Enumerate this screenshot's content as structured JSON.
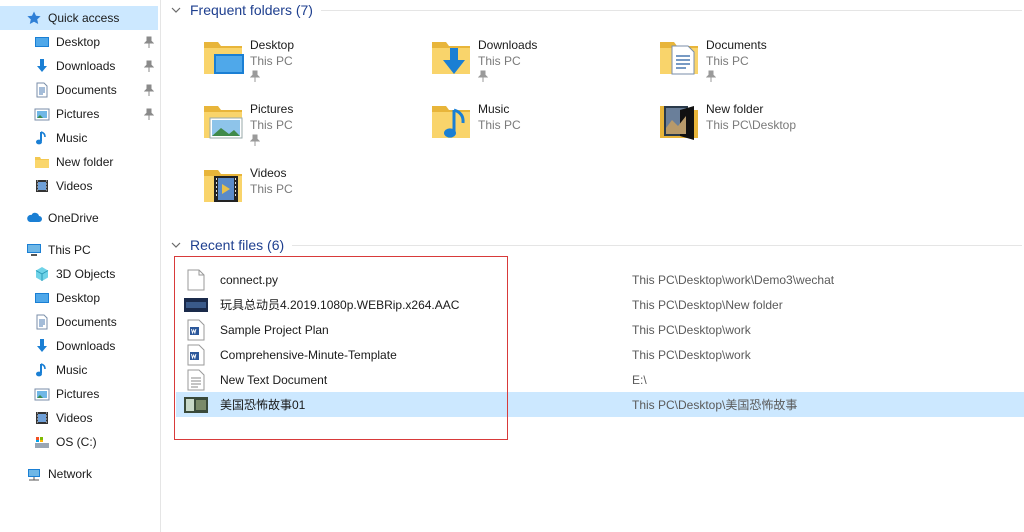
{
  "sidebar": {
    "quick_access": "Quick access",
    "qa_items": [
      {
        "label": "Desktop",
        "icon": "desktop-icon",
        "pinned": true
      },
      {
        "label": "Downloads",
        "icon": "downloads-icon",
        "pinned": true
      },
      {
        "label": "Documents",
        "icon": "documents-icon",
        "pinned": true
      },
      {
        "label": "Pictures",
        "icon": "pictures-icon",
        "pinned": true
      },
      {
        "label": "Music",
        "icon": "music-icon",
        "pinned": false
      },
      {
        "label": "New folder",
        "icon": "folder-icon",
        "pinned": false
      },
      {
        "label": "Videos",
        "icon": "videos-icon",
        "pinned": false
      }
    ],
    "onedrive": "OneDrive",
    "this_pc": "This PC",
    "pc_items": [
      {
        "label": "3D Objects",
        "icon": "3d-objects-icon"
      },
      {
        "label": "Desktop",
        "icon": "desktop-icon"
      },
      {
        "label": "Documents",
        "icon": "documents-icon"
      },
      {
        "label": "Downloads",
        "icon": "downloads-icon"
      },
      {
        "label": "Music",
        "icon": "music-icon"
      },
      {
        "label": "Pictures",
        "icon": "pictures-icon"
      },
      {
        "label": "Videos",
        "icon": "videos-icon"
      },
      {
        "label": "OS (C:)",
        "icon": "drive-icon"
      }
    ],
    "network": "Network"
  },
  "frequent": {
    "title": "Frequent folders (7)",
    "items": [
      {
        "name": "Desktop",
        "location": "This PC",
        "pinned": true,
        "icon": "desktop-folder-icon"
      },
      {
        "name": "Downloads",
        "location": "This PC",
        "pinned": true,
        "icon": "downloads-folder-icon"
      },
      {
        "name": "Documents",
        "location": "This PC",
        "pinned": true,
        "icon": "documents-folder-icon"
      },
      {
        "name": "Pictures",
        "location": "This PC",
        "pinned": true,
        "icon": "pictures-folder-icon"
      },
      {
        "name": "Music",
        "location": "This PC",
        "pinned": false,
        "icon": "music-folder-icon"
      },
      {
        "name": "New folder",
        "location": "This PC\\Desktop",
        "pinned": false,
        "icon": "dark-folder-icon"
      },
      {
        "name": "Videos",
        "location": "This PC",
        "pinned": false,
        "icon": "videos-folder-icon"
      }
    ]
  },
  "recent": {
    "title": "Recent files (6)",
    "items": [
      {
        "name": "connect.py",
        "path": "This PC\\Desktop\\work\\Demo3\\wechat",
        "icon": "blank-file-icon"
      },
      {
        "name": "玩具总动员4.2019.1080p.WEBRip.x264.AAC",
        "path": "This PC\\Desktop\\New folder",
        "icon": "video-thumbnail-icon"
      },
      {
        "name": "Sample Project Plan",
        "path": "This PC\\Desktop\\work",
        "icon": "word-document-icon"
      },
      {
        "name": "Comprehensive-Minute-Template",
        "path": "This PC\\Desktop\\work",
        "icon": "word-document-icon"
      },
      {
        "name": "New Text Document",
        "path": "E:\\",
        "icon": "text-file-icon"
      },
      {
        "name": "美国恐怖故事01",
        "path": "This PC\\Desktop\\美国恐怖故事",
        "icon": "video-thumbnail-icon",
        "selected": true
      }
    ]
  },
  "colors": {
    "selection": "#cce8ff",
    "header_text": "#1e3f8f",
    "folder_yellow": "#f3c851",
    "highlight_box": "#d83a3a"
  }
}
